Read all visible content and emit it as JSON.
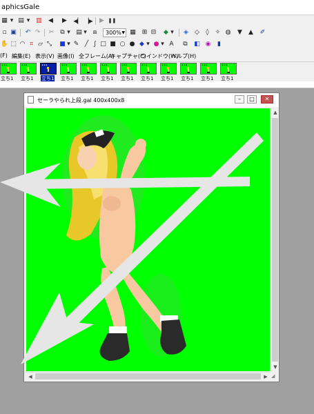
{
  "app": {
    "title": "aphicsGale"
  },
  "toolbar1": {
    "play_label": "▶",
    "pause_label": "❚❚"
  },
  "toolbar2": {
    "zoom_value": "300%"
  },
  "menubar": {
    "items": [
      "(F)",
      "編集(E)",
      "表示(V)",
      "画像(I)",
      "全フレーム(A)",
      "キャプチャ(C)",
      "ウインドウ(W)",
      "ヘルプ(H)"
    ]
  },
  "frames": {
    "label": "立ち1",
    "count": 12,
    "selected_index": 2
  },
  "image_window": {
    "title": "セーラやられ上段.gal 400x400x8",
    "background_color": "#00ff00",
    "minimize_label": "–",
    "maximize_label": "□",
    "close_label": "✕"
  },
  "colors": {
    "canvas_green": "#00ff00",
    "workspace_gray": "#a0a0a0",
    "selected_frame": "#001ea8",
    "arrow_white": "#e6e6e6"
  }
}
